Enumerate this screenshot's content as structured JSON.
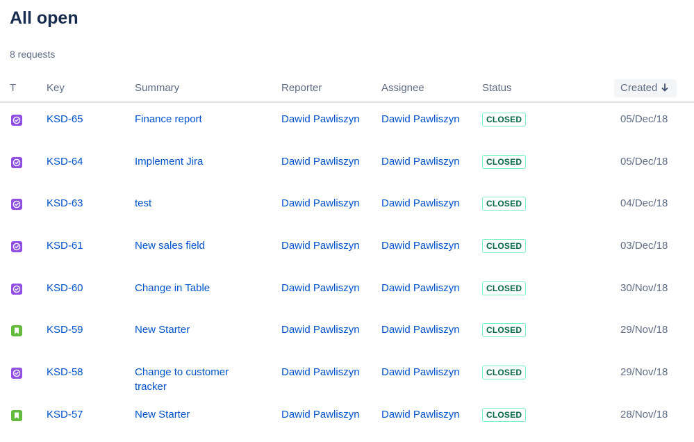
{
  "page": {
    "title": "All open",
    "count_label": "8 requests"
  },
  "columns": {
    "type": "T",
    "key": "Key",
    "summary": "Summary",
    "reporter": "Reporter",
    "assignee": "Assignee",
    "status": "Status",
    "created": "Created"
  },
  "sort": {
    "column": "created",
    "direction": "descending",
    "icon": "arrow-down-icon"
  },
  "colors": {
    "link": "#0052cc",
    "task_type": "#904ee2",
    "story_type": "#63ba3c",
    "status_text": "#006644",
    "status_border": "#79f2c0"
  },
  "rows": [
    {
      "type": "task",
      "type_icon": "task-icon",
      "key": "KSD-65",
      "summary": "Finance report",
      "reporter": "Dawid Pawliszyn",
      "assignee": "Dawid Pawliszyn",
      "status": "CLOSED",
      "created": "05/Dec/18"
    },
    {
      "type": "task",
      "type_icon": "task-icon",
      "key": "KSD-64",
      "summary": "Implement Jira",
      "reporter": "Dawid Pawliszyn",
      "assignee": "Dawid Pawliszyn",
      "status": "CLOSED",
      "created": "05/Dec/18"
    },
    {
      "type": "task",
      "type_icon": "task-icon",
      "key": "KSD-63",
      "summary": "test",
      "reporter": "Dawid Pawliszyn",
      "assignee": "Dawid Pawliszyn",
      "status": "CLOSED",
      "created": "04/Dec/18"
    },
    {
      "type": "task",
      "type_icon": "task-icon",
      "key": "KSD-61",
      "summary": "New sales field",
      "reporter": "Dawid Pawliszyn",
      "assignee": "Dawid Pawliszyn",
      "status": "CLOSED",
      "created": "03/Dec/18"
    },
    {
      "type": "task",
      "type_icon": "task-icon",
      "key": "KSD-60",
      "summary": "Change in Table",
      "reporter": "Dawid Pawliszyn",
      "assignee": "Dawid Pawliszyn",
      "status": "CLOSED",
      "created": "30/Nov/18"
    },
    {
      "type": "story",
      "type_icon": "bookmark-icon",
      "key": "KSD-59",
      "summary": "New Starter",
      "reporter": "Dawid Pawliszyn",
      "assignee": "Dawid Pawliszyn",
      "status": "CLOSED",
      "created": "29/Nov/18"
    },
    {
      "type": "task",
      "type_icon": "task-icon",
      "key": "KSD-58",
      "summary": "Change to customer tracker",
      "reporter": "Dawid Pawliszyn",
      "assignee": "Dawid Pawliszyn",
      "status": "CLOSED",
      "created": "29/Nov/18"
    },
    {
      "type": "story",
      "type_icon": "bookmark-icon",
      "key": "KSD-57",
      "summary": "New Starter",
      "reporter": "Dawid Pawliszyn",
      "assignee": "Dawid Pawliszyn",
      "status": "CLOSED",
      "created": "28/Nov/18"
    }
  ]
}
